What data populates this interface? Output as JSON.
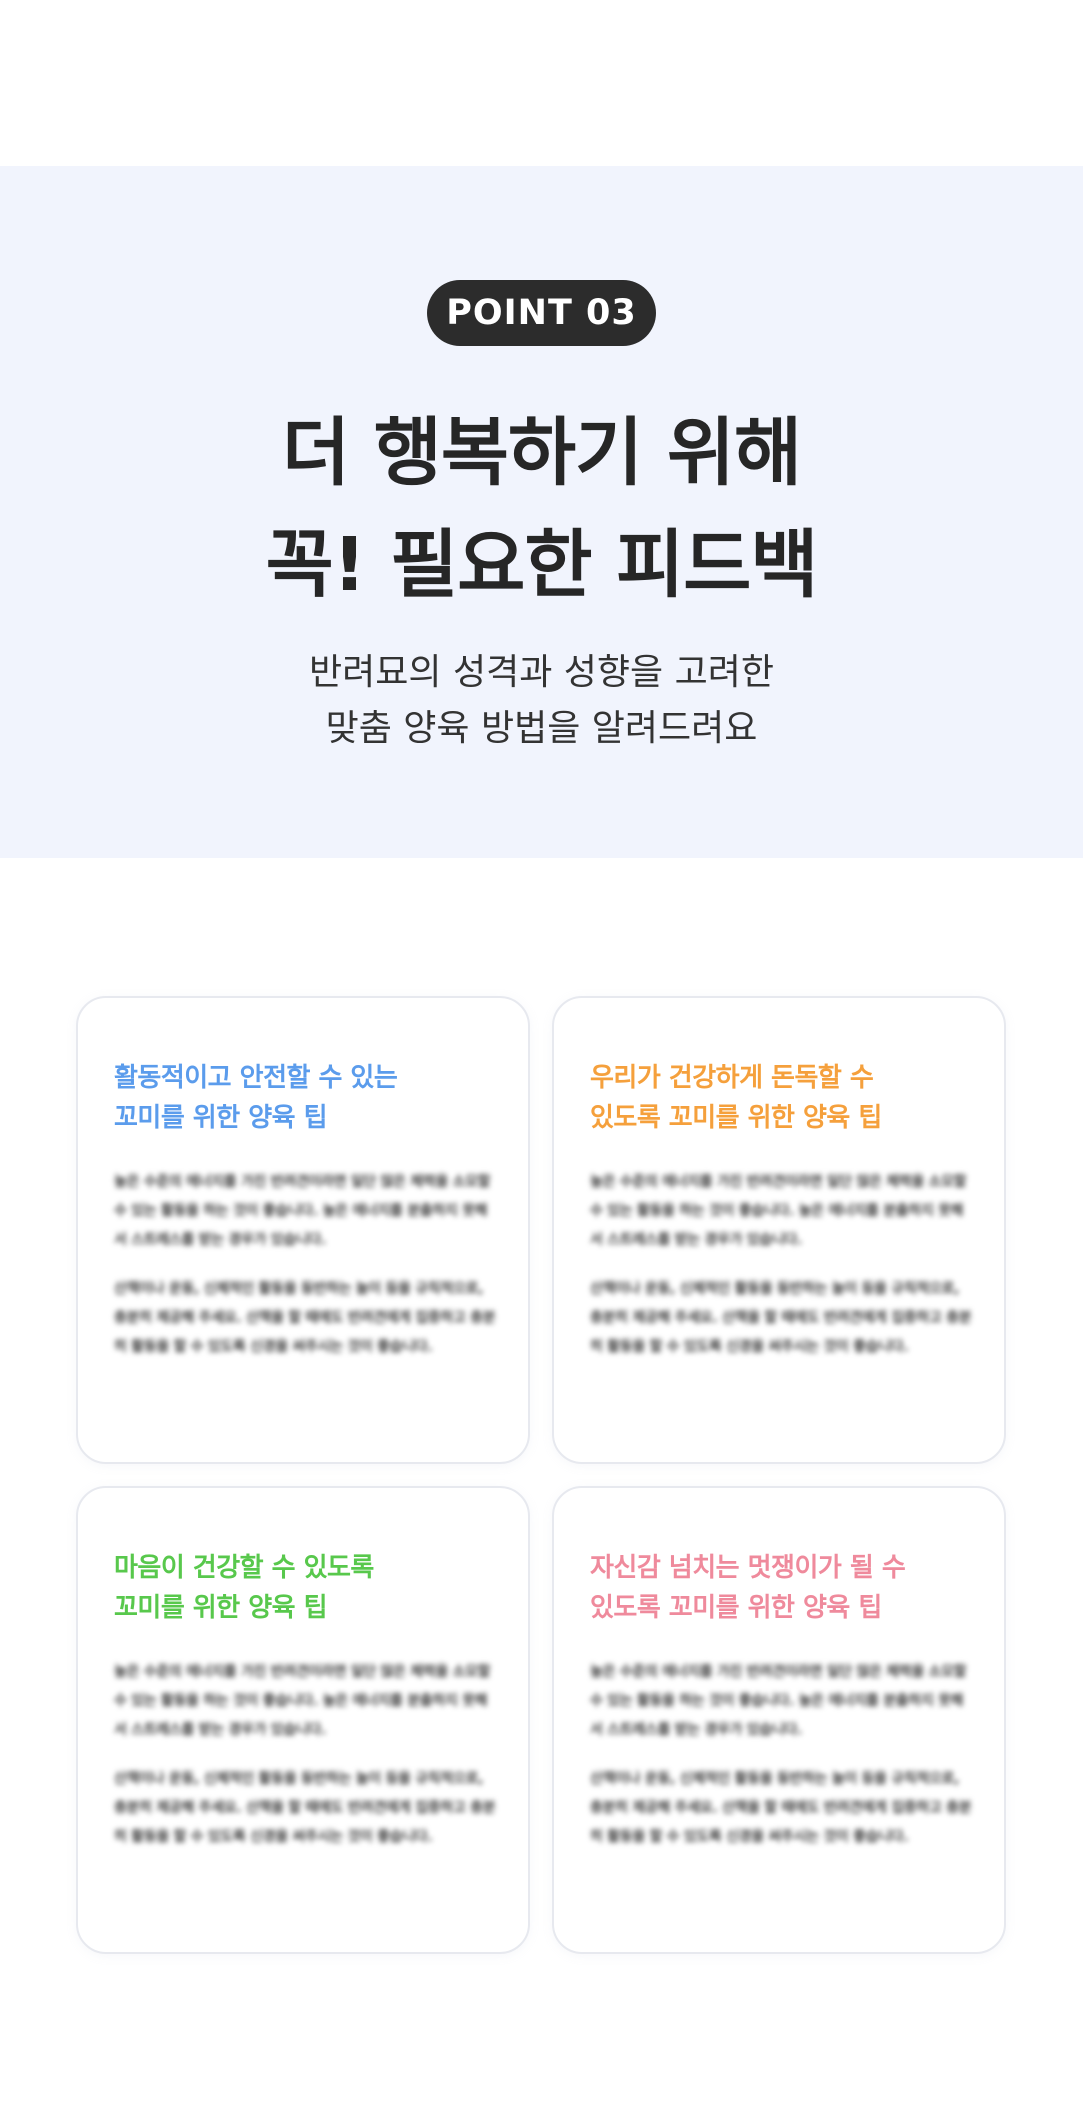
{
  "hero": {
    "badge": "POINT 03",
    "headline_line1": "더 행복하기 위해",
    "headline_line2": "꼭! 필요한 피드백",
    "subline_line1": "반려묘의 성격과 성향을 고려한",
    "subline_line2": "맞춤 양육 방법을 알려드려요"
  },
  "cards": [
    {
      "title_line1": "활동적이고 안전할 수 있는",
      "title_line2": "꼬미를 위한 양육 팁",
      "color": "#5b9cec",
      "body_paragraph1": "높은 수준의 에너지를 가진 반려견이라면 일단 많은 체력을 소모할 수 있는 활동을 하는 것이 좋습니다. 높은 에너지를 분출하지 못해서 스트레스를 받는 경우가 있습니다.",
      "body_paragraph2": "산책이나 운동, 신체적인 활동을 동반하는 놀이 등을 규칙적으로, 충분히 제공해 주세요. 산책을 할 때에도 반려견에게 집중하고 충분히 활동을 할 수 있도록 신경을 써주시는 것이 좋습니다."
    },
    {
      "title_line1": "우리가 건강하게 돈독할 수",
      "title_line2": "있도록 꼬미를 위한 양육 팁",
      "color": "#f5a03c",
      "body_paragraph1": "높은 수준의 에너지를 가진 반려견이라면 일단 많은 체력을 소모할 수 있는 활동을 하는 것이 좋습니다. 높은 에너지를 분출하지 못해서 스트레스를 받는 경우가 있습니다.",
      "body_paragraph2": "산책이나 운동, 신체적인 활동을 동반하는 놀이 등을 규칙적으로, 충분히 제공해 주세요. 산책을 할 때에도 반려견에게 집중하고 충분히 활동을 할 수 있도록 신경을 써주시는 것이 좋습니다."
    },
    {
      "title_line1": "마음이 건강할 수 있도록",
      "title_line2": "꼬미를 위한 양육 팁",
      "color": "#58c84c",
      "body_paragraph1": "높은 수준의 에너지를 가진 반려견이라면 일단 많은 체력을 소모할 수 있는 활동을 하는 것이 좋습니다. 높은 에너지를 분출하지 못해서 스트레스를 받는 경우가 있습니다.",
      "body_paragraph2": "산책이나 운동, 신체적인 활동을 동반하는 놀이 등을 규칙적으로, 충분히 제공해 주세요. 산책을 할 때에도 반려견에게 집중하고 충분히 활동을 할 수 있도록 신경을 써주시는 것이 좋습니다."
    },
    {
      "title_line1": "자신감 넘치는 멋쟁이가 될 수",
      "title_line2": "있도록 꼬미를 위한 양육 팁",
      "color": "#ef8a9c",
      "body_paragraph1": "높은 수준의 에너지를 가진 반려견이라면 일단 많은 체력을 소모할 수 있는 활동을 하는 것이 좋습니다. 높은 에너지를 분출하지 못해서 스트레스를 받는 경우가 있습니다.",
      "body_paragraph2": "산책이나 운동, 신체적인 활동을 동반하는 놀이 등을 규칙적으로, 충분히 제공해 주세요. 산책을 할 때에도 반려견에게 집중하고 충분히 활동을 할 수 있도록 신경을 써주시는 것이 좋습니다."
    }
  ]
}
